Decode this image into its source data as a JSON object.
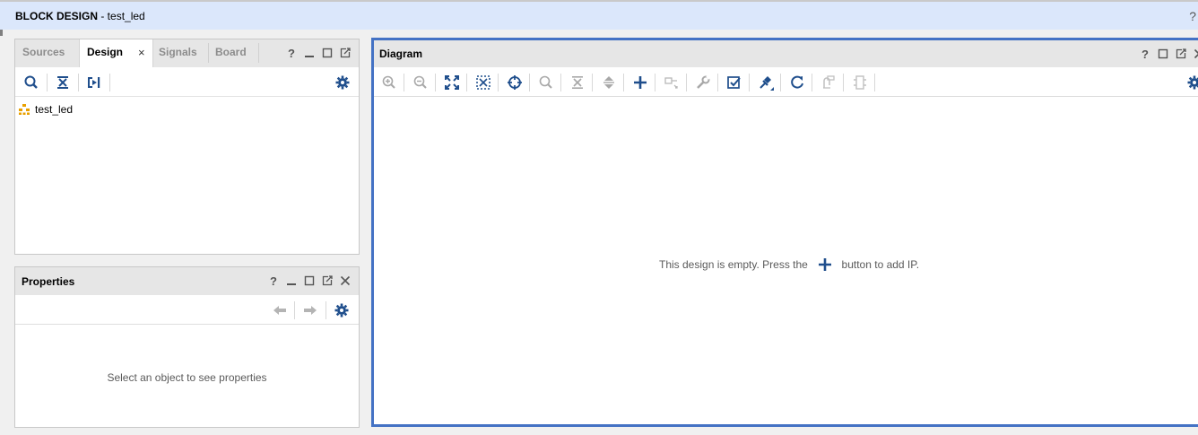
{
  "titlebar": {
    "title_bold": "BLOCK DESIGN",
    "title_rest": " - test_led",
    "help": "?"
  },
  "sources_panel": {
    "tabs": [
      {
        "label": "Sources",
        "active": false
      },
      {
        "label": "Design",
        "active": true
      },
      {
        "label": "Signals",
        "active": false
      },
      {
        "label": "Board",
        "active": false
      }
    ],
    "close_glyph": "×",
    "tree": [
      {
        "label": "test_led",
        "icon": "hierarchy-icon"
      }
    ]
  },
  "properties_panel": {
    "title": "Properties",
    "empty_message": "Select an object to see properties"
  },
  "diagram_panel": {
    "title": "Diagram",
    "empty_message_before": "This design is empty. Press the",
    "empty_message_after": "button to add IP."
  },
  "colors": {
    "accent": "#4472c4",
    "icon_blue": "#1f4e8c",
    "icon_gray": "#a8a8a8",
    "icon_orange": "#e8a000"
  }
}
